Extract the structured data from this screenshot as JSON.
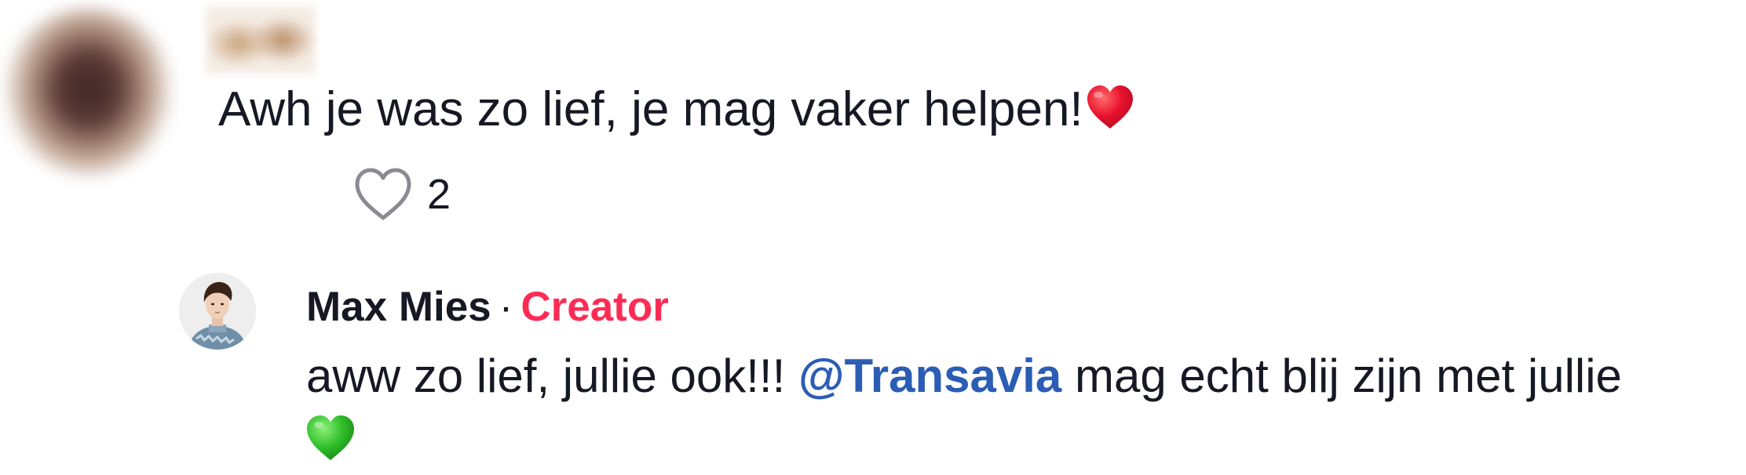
{
  "comment": {
    "avatar_icon": "blurred-user-avatar",
    "username_icon": "blurred-username",
    "text": "Awh je was zo lief, je mag vaker helpen!",
    "emoji": "red-heart",
    "like_icon": "heart-outline-icon",
    "like_count": "2"
  },
  "reply": {
    "avatar_icon": "creator-avatar",
    "author": "Max Mies",
    "separator": "·",
    "badge": "Creator",
    "text_before": "aww zo lief, jullie ook!!! ",
    "mention": "@Transavia",
    "text_after": " mag echt blij zijn met jullie",
    "emoji": "green-heart"
  },
  "colors": {
    "text": "#161823",
    "creator": "#fe2c55",
    "mention": "#2b5db5",
    "heart_red": "#e8112d",
    "heart_green": "#2fbf2a",
    "icon_gray": "#8a8b91"
  }
}
